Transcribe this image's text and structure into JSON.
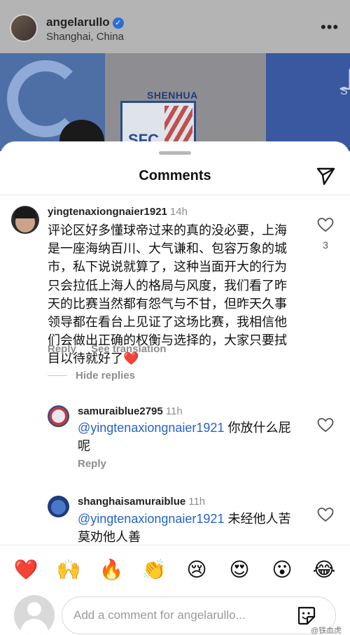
{
  "post": {
    "username": "angelarullo",
    "location": "Shanghai, China",
    "more_label": "•••",
    "image_text_club": "SHENHUA",
    "image_text_badge": "SFC",
    "image_text_right": "上",
    "image_text_right_sub": "S"
  },
  "sheet": {
    "title": "Comments"
  },
  "comments": [
    {
      "username": "yingtenaxiongnaier1921",
      "time": "14h",
      "text": "评论区好多懂球帝过来的真的没必要，上海是一座海纳百川、大气谦和、包容万象的城市，私下说说就算了，这种当面开大的行为只会拉低上海人的格局与风度，我们看了昨天的比赛当然都有怨气与不甘，但昨天久事领导都在看台上见证了这场比赛，我相信他们会做出正确的权衡与选择的，大家只要拭目以待就好了❤️",
      "reply_label": "Reply",
      "translate_label": "See translation",
      "likes": "3"
    }
  ],
  "hide_replies_label": "Hide replies",
  "replies": [
    {
      "username": "samuraiblue2795",
      "time": "11h",
      "mention": "@yingtenaxiongnaier1921",
      "text": " 你放什么屁呢",
      "reply_label": "Reply"
    },
    {
      "username": "shanghaisamuraiblue",
      "time": "11h",
      "mention": "@yingtenaxiongnaier1921",
      "text": " 未经他人苦莫劝他人善"
    }
  ],
  "emojis": [
    "❤️",
    "🙌",
    "🔥",
    "👏",
    "😢",
    "😍",
    "😮",
    "😂"
  ],
  "composer": {
    "placeholder": "Add a comment for angelarullo..."
  },
  "watermark": "@铁血虎"
}
